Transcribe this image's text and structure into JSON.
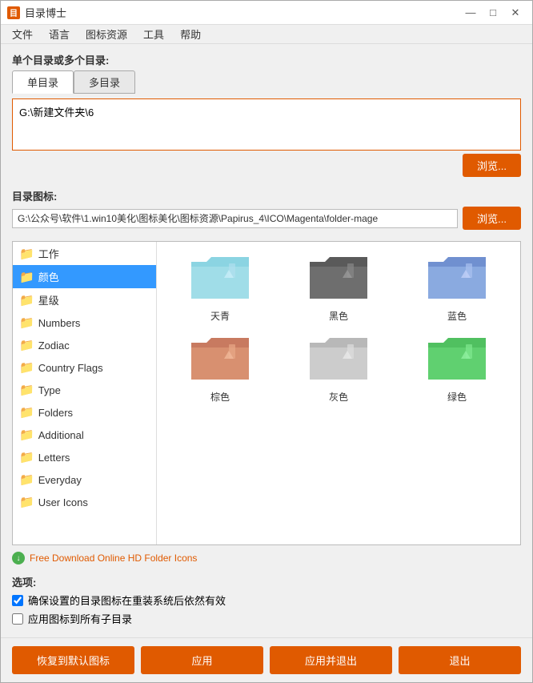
{
  "window": {
    "title": "目录博士",
    "icon_label": "目"
  },
  "title_controls": {
    "minimize": "—",
    "maximize": "□",
    "close": "✕"
  },
  "menu": {
    "items": [
      "文件",
      "语言",
      "图标资源",
      "工具",
      "帮助"
    ]
  },
  "section1": {
    "label": "单个目录或多个目录:",
    "tab_single": "单目录",
    "tab_multi": "多目录",
    "path_value": "G:\\新建文件夹\\6",
    "browse_label": "浏览..."
  },
  "section2": {
    "label": "目录图标:",
    "icon_path": "G:\\公众号\\软件\\1.win10美化\\图标美化\\图标资源\\Papirus_4\\ICO\\Magenta\\folder-mage",
    "browse_label": "浏览..."
  },
  "sidebar": {
    "items": [
      {
        "label": "工作",
        "selected": false
      },
      {
        "label": "颜色",
        "selected": true
      },
      {
        "label": "星级",
        "selected": false
      },
      {
        "label": "Numbers",
        "selected": false
      },
      {
        "label": "Zodiac",
        "selected": false
      },
      {
        "label": "Country Flags",
        "selected": false
      },
      {
        "label": "Type",
        "selected": false
      },
      {
        "label": "Folders",
        "selected": false
      },
      {
        "label": "Additional",
        "selected": false
      },
      {
        "label": "Letters",
        "selected": false
      },
      {
        "label": "Everyday",
        "selected": false
      },
      {
        "label": "User Icons",
        "selected": false
      }
    ]
  },
  "icon_grid": {
    "items": [
      {
        "label": "天青",
        "color": "cyan"
      },
      {
        "label": "黑色",
        "color": "dark"
      },
      {
        "label": "蓝色",
        "color": "blue"
      },
      {
        "label": "棕色",
        "color": "brown"
      },
      {
        "label": "灰色",
        "color": "gray"
      },
      {
        "label": "绿色",
        "color": "green"
      }
    ]
  },
  "ad_link": {
    "text": "Free Download Online HD Folder Icons"
  },
  "options": {
    "label": "选项:",
    "checkbox1": {
      "label": "确保设置的目录图标在重装系统后依然有效",
      "checked": true
    },
    "checkbox2": {
      "label": "应用图标到所有子目录",
      "checked": false
    }
  },
  "footer": {
    "btn_restore": "恢复到默认图标",
    "btn_apply": "应用",
    "btn_apply_exit": "应用并退出",
    "btn_exit": "退出"
  },
  "colors": {
    "accent": "#e05a00",
    "selected_bg": "#3399ff"
  }
}
